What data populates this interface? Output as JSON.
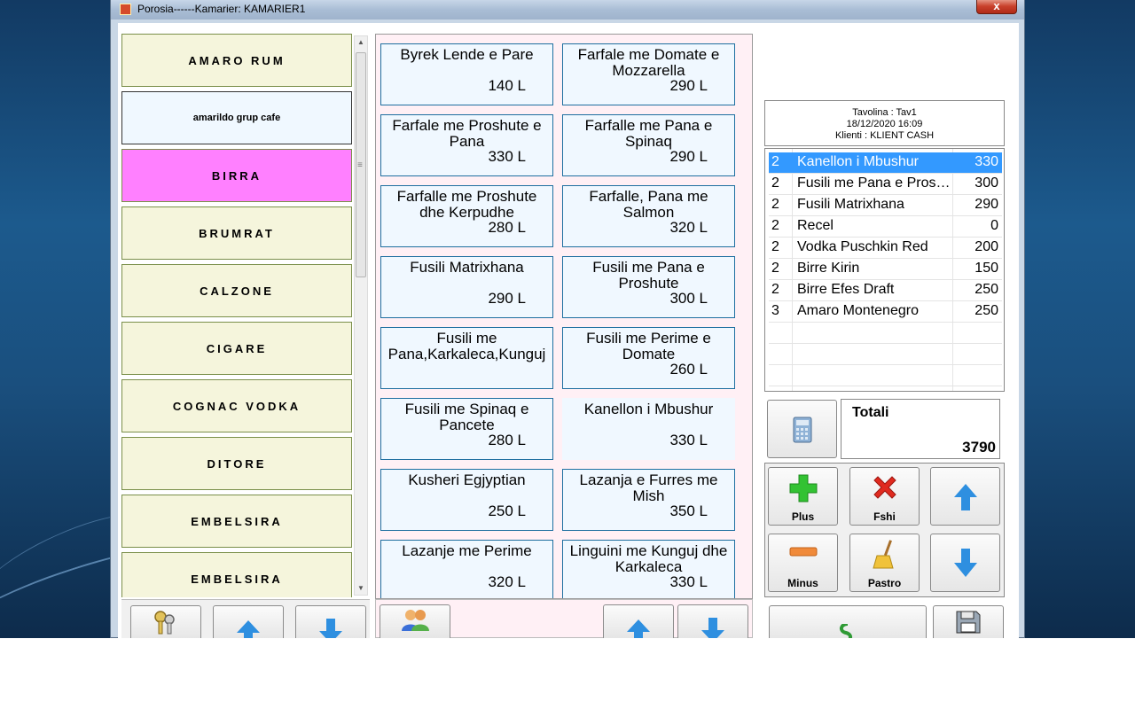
{
  "window": {
    "title": "Porosia------Kamarier: KAMARIER1",
    "close_label": "x"
  },
  "categories": [
    {
      "label": "AMARO RUM",
      "style": "normal"
    },
    {
      "label": "amarildo grup cafe",
      "style": "small"
    },
    {
      "label": "BIRRA",
      "style": "pink"
    },
    {
      "label": "BRUMRAT",
      "style": "normal"
    },
    {
      "label": "CALZONE",
      "style": "normal"
    },
    {
      "label": "CIGARE",
      "style": "normal"
    },
    {
      "label": "COGNAC VODKA",
      "style": "normal"
    },
    {
      "label": "DITORE",
      "style": "normal"
    },
    {
      "label": "EMBELSIRA",
      "style": "normal"
    },
    {
      "label": "EMBELSIRA",
      "style": "normal"
    }
  ],
  "products": [
    {
      "name": "Byrek Lende e Pare",
      "price": "140 L"
    },
    {
      "name": "Farfale me Domate e Mozzarella",
      "price": "290 L"
    },
    {
      "name": "Farfale me Proshute e Pana",
      "price": "330 L"
    },
    {
      "name": "Farfalle me Pana e Spinaq",
      "price": "290 L"
    },
    {
      "name": "Farfalle me Proshute dhe Kerpudhe",
      "price": "280 L"
    },
    {
      "name": "Farfalle, Pana me Salmon",
      "price": "320 L"
    },
    {
      "name": "Fusili Matrixhana",
      "price": "290 L"
    },
    {
      "name": "Fusili me Pana e Proshute",
      "price": "300 L"
    },
    {
      "name": "Fusili me Pana,Karkaleca,Kunguj",
      "price": ""
    },
    {
      "name": "Fusili me Perime e Domate",
      "price": "260 L"
    },
    {
      "name": "Fusili me Spinaq e Pancete",
      "price": "280 L"
    },
    {
      "name": "Kanellon i Mbushur",
      "price": "330 L"
    },
    {
      "name": "Kusheri Egjyptian",
      "price": "250 L"
    },
    {
      "name": "Lazanja e Furres me Mish",
      "price": "350 L"
    },
    {
      "name": "Lazanje me Perime",
      "price": "320 L"
    },
    {
      "name": "Linguini me Kunguj dhe Karkaleca",
      "price": "330 L"
    }
  ],
  "info": {
    "table": "Tavolina : Tav1",
    "datetime": "18/12/2020 16:09",
    "client": "Klienti : KLIENT CASH"
  },
  "order": [
    {
      "qty": "2",
      "name": "Kanellon i Mbushur",
      "amount": "330",
      "selected": true
    },
    {
      "qty": "2",
      "name": "Fusili me Pana e Proshute",
      "amount": "300"
    },
    {
      "qty": "2",
      "name": "Fusili Matrixhana",
      "amount": "290"
    },
    {
      "qty": "2",
      "name": "Recel",
      "amount": "0"
    },
    {
      "qty": "2",
      "name": "Vodka Puschkin Red",
      "amount": "200"
    },
    {
      "qty": "2",
      "name": "Birre Kirin",
      "amount": "150"
    },
    {
      "qty": "2",
      "name": "Birre Efes Draft",
      "amount": "250"
    },
    {
      "qty": "3",
      "name": "Amaro Montenegro",
      "amount": "250"
    }
  ],
  "total": {
    "label": "Totali",
    "value": "3790"
  },
  "actions": {
    "plus": "Plus",
    "delete": "Fshi",
    "minus": "Minus",
    "clear": "Pastro"
  },
  "colors": {
    "selected_category": "#ff80ff",
    "category_bg": "#f5f5dc",
    "selected_row": "#3399ff"
  }
}
